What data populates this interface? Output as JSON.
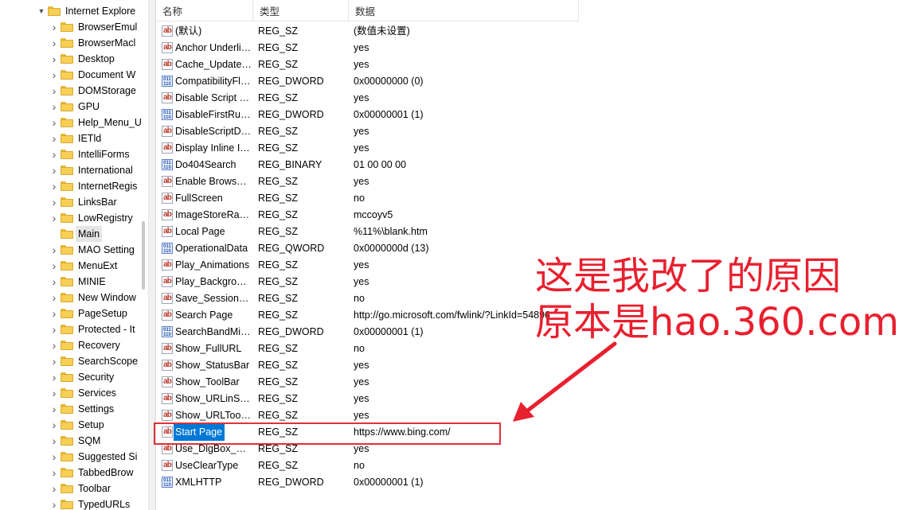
{
  "tree": {
    "items": [
      {
        "label": "Internet Explore",
        "expanded": true
      },
      {
        "label": "BrowserEmul"
      },
      {
        "label": "BrowserMacl"
      },
      {
        "label": "Desktop"
      },
      {
        "label": "Document W"
      },
      {
        "label": "DOMStorage"
      },
      {
        "label": "GPU"
      },
      {
        "label": "Help_Menu_U"
      },
      {
        "label": "IETld"
      },
      {
        "label": "IntelliForms"
      },
      {
        "label": "International"
      },
      {
        "label": "InternetRegis"
      },
      {
        "label": "LinksBar"
      },
      {
        "label": "LowRegistry"
      },
      {
        "label": "Main",
        "selected": true
      },
      {
        "label": "MAO Setting"
      },
      {
        "label": "MenuExt"
      },
      {
        "label": "MINIE"
      },
      {
        "label": "New Window"
      },
      {
        "label": "PageSetup"
      },
      {
        "label": "Protected - It"
      },
      {
        "label": "Recovery"
      },
      {
        "label": "SearchScope"
      },
      {
        "label": "Security"
      },
      {
        "label": "Services"
      },
      {
        "label": "Settings"
      },
      {
        "label": "Setup"
      },
      {
        "label": "SQM"
      },
      {
        "label": "Suggested Si"
      },
      {
        "label": "TabbedBrow"
      },
      {
        "label": "Toolbar"
      },
      {
        "label": "TypedURLs"
      }
    ]
  },
  "list": {
    "headers": {
      "name": "名称",
      "type": "类型",
      "data": "数据"
    },
    "rows": [
      {
        "name": "(默认)",
        "type": "REG_SZ",
        "data": "(数值未设置)",
        "icon": "string-value-icon"
      },
      {
        "name": "Anchor Underline",
        "type": "REG_SZ",
        "data": "yes",
        "icon": "string-value-icon"
      },
      {
        "name": "Cache_Update_Frequency",
        "type": "REG_SZ",
        "data": "yes",
        "icon": "string-value-icon"
      },
      {
        "name": "CompatibilityFlags",
        "type": "REG_DWORD",
        "data": "0x00000000 (0)",
        "icon": "binary-value-icon"
      },
      {
        "name": "Disable Script Debugger",
        "type": "REG_SZ",
        "data": "yes",
        "icon": "string-value-icon"
      },
      {
        "name": "DisableFirstRunCustomize",
        "type": "REG_DWORD",
        "data": "0x00000001 (1)",
        "icon": "binary-value-icon"
      },
      {
        "name": "DisableScriptDebuggerIE",
        "type": "REG_SZ",
        "data": "yes",
        "icon": "string-value-icon"
      },
      {
        "name": "Display Inline Images",
        "type": "REG_SZ",
        "data": "yes",
        "icon": "string-value-icon"
      },
      {
        "name": "Do404Search",
        "type": "REG_BINARY",
        "data": "01 00 00 00",
        "icon": "binary-value-icon"
      },
      {
        "name": "Enable Browser Extensions",
        "type": "REG_SZ",
        "data": "yes",
        "icon": "string-value-icon"
      },
      {
        "name": "FullScreen",
        "type": "REG_SZ",
        "data": "no",
        "icon": "string-value-icon"
      },
      {
        "name": "ImageStoreRandomFolder",
        "type": "REG_SZ",
        "data": "mccoyv5",
        "icon": "string-value-icon"
      },
      {
        "name": "Local Page",
        "type": "REG_SZ",
        "data": "%11%\\blank.htm",
        "icon": "string-value-icon"
      },
      {
        "name": "OperationalData",
        "type": "REG_QWORD",
        "data": "0x0000000d (13)",
        "icon": "binary-value-icon"
      },
      {
        "name": "Play_Animations",
        "type": "REG_SZ",
        "data": "yes",
        "icon": "string-value-icon"
      },
      {
        "name": "Play_Background_Sounds",
        "type": "REG_SZ",
        "data": "yes",
        "icon": "string-value-icon"
      },
      {
        "name": "Save_Session_History_On_Exit",
        "type": "REG_SZ",
        "data": "no",
        "icon": "string-value-icon"
      },
      {
        "name": "Search Page",
        "type": "REG_SZ",
        "data": "http://go.microsoft.com/fwlink/?LinkId=54896",
        "icon": "string-value-icon"
      },
      {
        "name": "SearchBandMigrationVersion",
        "type": "REG_DWORD",
        "data": "0x00000001 (1)",
        "icon": "binary-value-icon"
      },
      {
        "name": "Show_FullURL",
        "type": "REG_SZ",
        "data": "no",
        "icon": "string-value-icon"
      },
      {
        "name": "Show_StatusBar",
        "type": "REG_SZ",
        "data": "yes",
        "icon": "string-value-icon"
      },
      {
        "name": "Show_ToolBar",
        "type": "REG_SZ",
        "data": "yes",
        "icon": "string-value-icon"
      },
      {
        "name": "Show_URLinStatusBar",
        "type": "REG_SZ",
        "data": "yes",
        "icon": "string-value-icon"
      },
      {
        "name": "Show_URLToolBar",
        "type": "REG_SZ",
        "data": "yes",
        "icon": "string-value-icon"
      },
      {
        "name": "Start Page",
        "type": "REG_SZ",
        "data": "https://www.bing.com/",
        "icon": "string-value-icon",
        "selected": true
      },
      {
        "name": "Use_DlgBox_Colors",
        "type": "REG_SZ",
        "data": "yes",
        "icon": "string-value-icon"
      },
      {
        "name": "UseClearType",
        "type": "REG_SZ",
        "data": "no",
        "icon": "string-value-icon"
      },
      {
        "name": "XMLHTTP",
        "type": "REG_DWORD",
        "data": "0x00000001 (1)",
        "icon": "binary-value-icon"
      }
    ]
  },
  "annotation": {
    "line1": "这是我改了的原因",
    "line2": "原本是hao.360.com",
    "color": "#e8202f"
  }
}
